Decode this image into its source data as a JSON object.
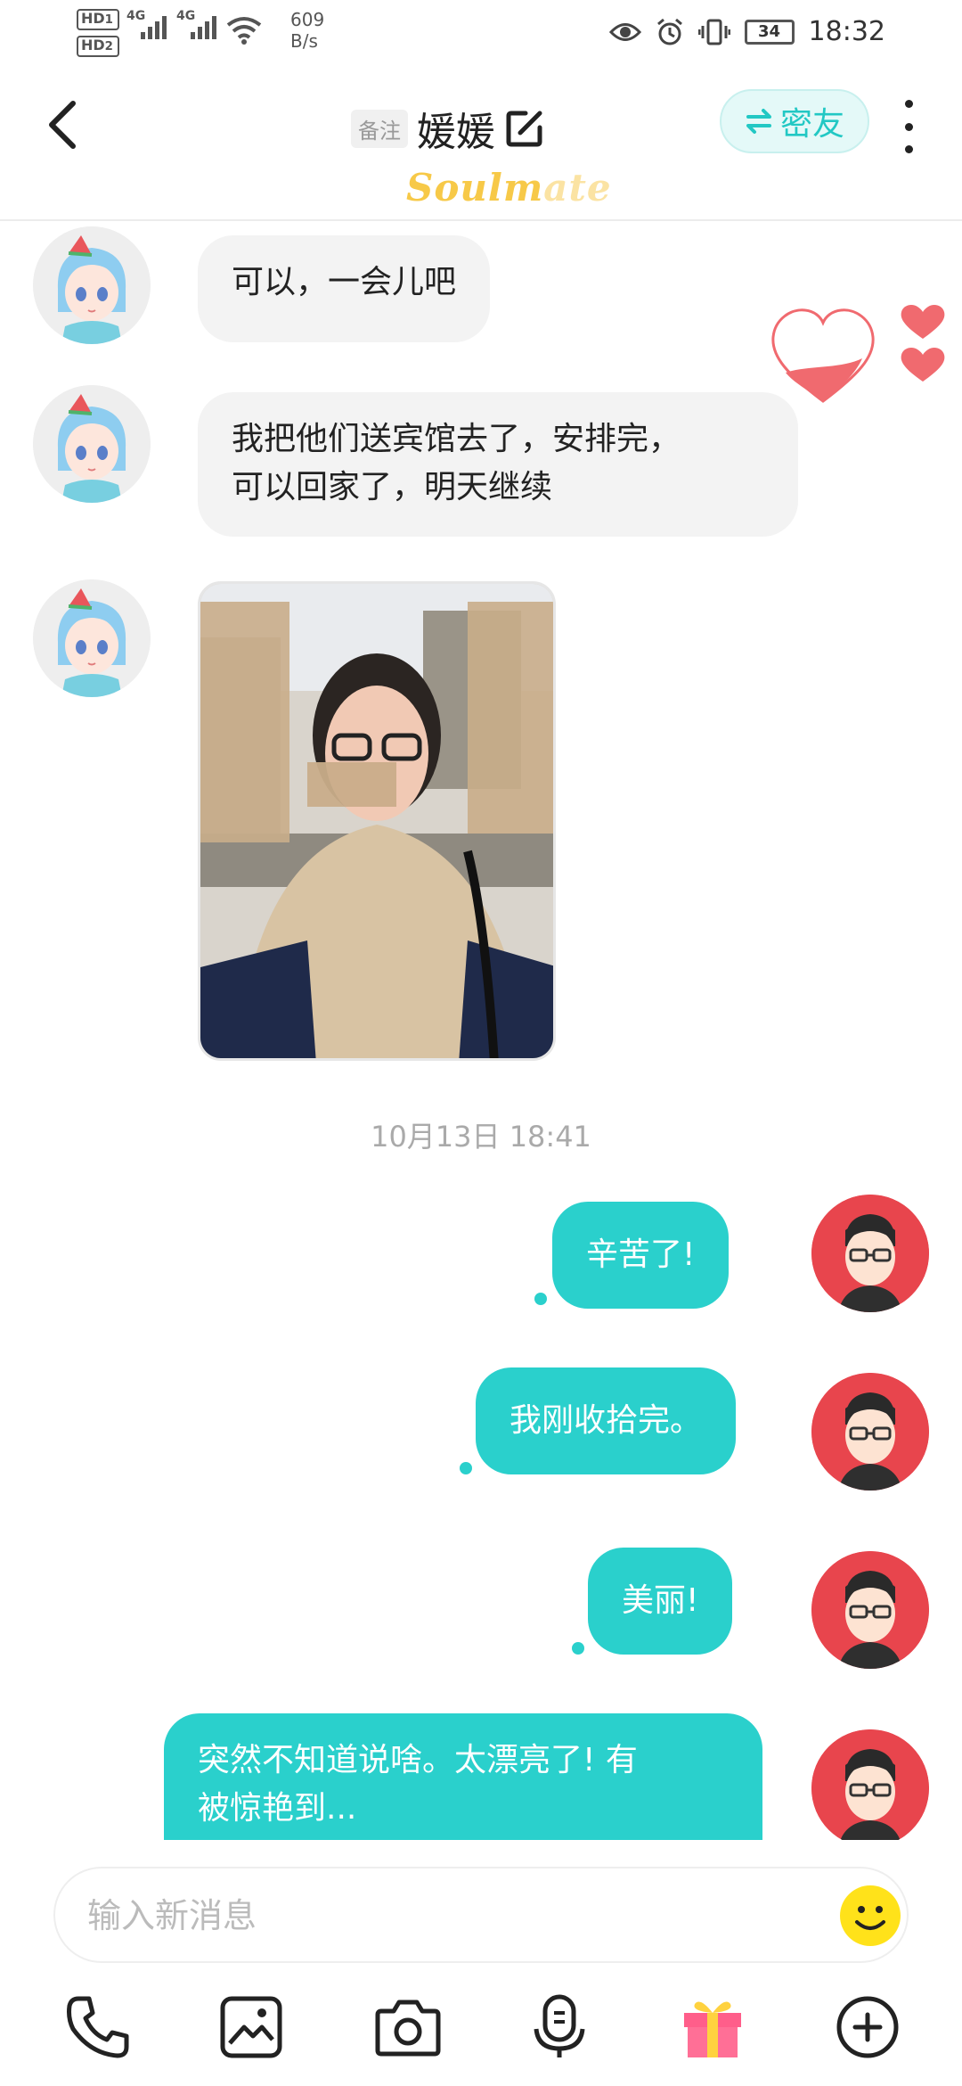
{
  "status_bar": {
    "sim1_label": "HD",
    "sim1_num": "1",
    "sim2_label": "HD",
    "sim2_num": "2",
    "net_type_1": "4G",
    "net_type_2": "4G",
    "speed_value": "609",
    "speed_unit": "B/s",
    "battery": "34",
    "time": "18:32"
  },
  "header": {
    "remark_tag": "备注",
    "title": "媛媛",
    "friend_button": "密友",
    "logo_main": "Soulm",
    "logo_fade": "ate"
  },
  "messages": {
    "incoming": [
      {
        "text": "可以，一会儿吧"
      },
      {
        "text_line1": "我把他们送宾馆去了，安排完，",
        "text_line2": "可以回家了，明天继续"
      }
    ],
    "timestamp": "10月13日 18:41",
    "outgoing": [
      {
        "text": "辛苦了!"
      },
      {
        "text": "我刚收拾完。"
      },
      {
        "text": "美丽!"
      },
      {
        "text_line1": "突然不知道说啥。太漂亮了! 有",
        "text_line2": "被惊艳到..."
      }
    ]
  },
  "input": {
    "placeholder": "输入新消息"
  },
  "icons": {
    "toolbar": [
      "phone-icon",
      "image-icon",
      "camera-icon",
      "voice-icon",
      "gift-icon",
      "plus-icon"
    ]
  },
  "colors": {
    "accent": "#2ad0cc",
    "incoming_bubble": "#f3f3f3",
    "heart": "#f06a6f",
    "logo": "#f7c948"
  }
}
